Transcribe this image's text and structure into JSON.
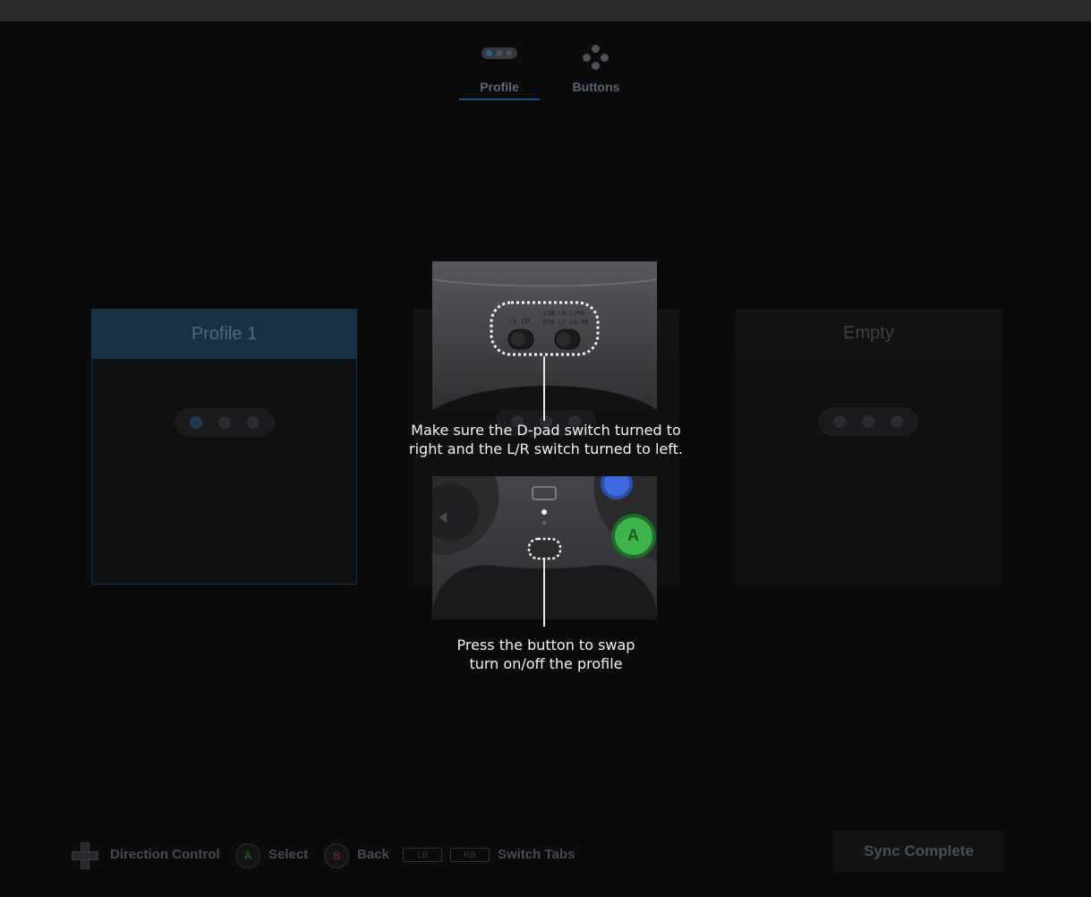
{
  "tabs": [
    {
      "label": "Profile",
      "icon": "profile-pill-icon",
      "active": true
    },
    {
      "label": "Buttons",
      "icon": "buttons-cluster-icon",
      "active": false
    }
  ],
  "profiles": [
    {
      "name": "Profile 1",
      "selected": true
    },
    {
      "name": "",
      "selected": false
    },
    {
      "name": "Empty",
      "selected": false
    }
  ],
  "overlay": {
    "switch_instruction": "Make sure the D-pad switch  turned to\nright and the L/R switch turned to left.",
    "button_instruction": "Press the button to swap\nturn on/off the profile",
    "switch_labels": {
      "left": "LS  DP",
      "right_top": "LSB LB  L/RB",
      "right_bottom": "RSB LT  LB RB"
    },
    "face_button_letter": "A"
  },
  "footer": {
    "direction_label": "Direction Control",
    "select_key": "A",
    "select_label": "Select",
    "back_key": "B",
    "back_label": "Back",
    "lb_key": "LB",
    "rb_key": "RB",
    "switch_tabs_label": "Switch Tabs",
    "sync_label": "Sync Complete"
  },
  "colors": {
    "accent": "#1f4f78",
    "background": "#0b0b0c",
    "select_key": "#2f6b3a",
    "back_key": "#7a2a2a"
  }
}
